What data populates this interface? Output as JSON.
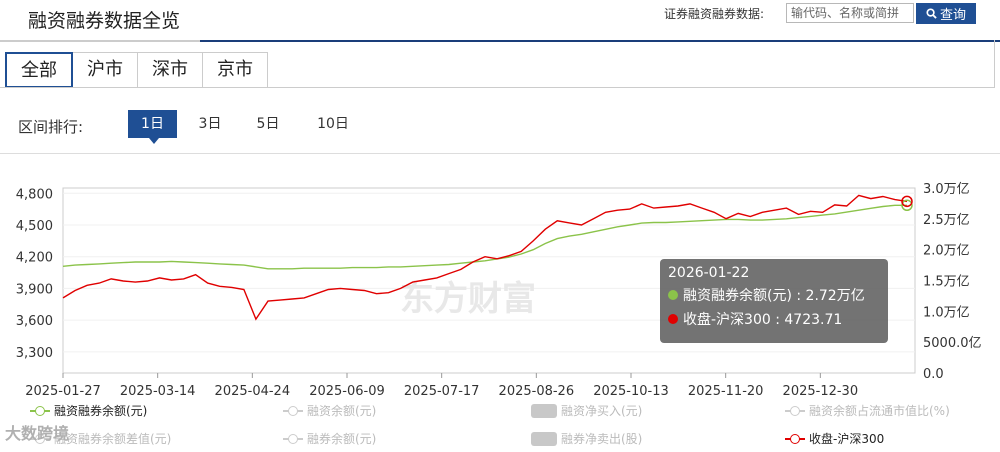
{
  "header": {
    "title": "融资融券数据全览",
    "search_label": "证券融资融券数据:",
    "search_placeholder": "输代码、名称或简拼",
    "search_button": "查询"
  },
  "tabs": [
    {
      "label": "全部",
      "active": true
    },
    {
      "label": "沪市",
      "active": false
    },
    {
      "label": "深市",
      "active": false
    },
    {
      "label": "京市",
      "active": false
    }
  ],
  "range": {
    "label": "区间排行:",
    "options": [
      {
        "label": "1日",
        "active": true
      },
      {
        "label": "3日",
        "active": false
      },
      {
        "label": "5日",
        "active": false
      },
      {
        "label": "10日",
        "active": false
      }
    ]
  },
  "legend": [
    {
      "label": "融资融券余额(元)",
      "style": "line-dot",
      "color": "#8bc34a",
      "active": true
    },
    {
      "label": "融资余额(元)",
      "style": "line-dot",
      "color": "#cccccc",
      "active": false
    },
    {
      "label": "融资净买入(元)",
      "style": "box",
      "color": "#cccccc",
      "active": false
    },
    {
      "label": "融资余额占流通市值比(%)",
      "style": "line-dot",
      "color": "#cccccc",
      "active": false
    },
    {
      "label": "融资融券余额差值(元)",
      "style": "line-dot",
      "color": "#cccccc",
      "active": false
    },
    {
      "label": "融券余额(元)",
      "style": "line-dot",
      "color": "#cccccc",
      "active": false
    },
    {
      "label": "融券净卖出(股)",
      "style": "box",
      "color": "#cccccc",
      "active": false
    },
    {
      "label": "收盘-沪深300",
      "style": "line-dot",
      "color": "#e00000",
      "active": true
    }
  ],
  "tooltip": {
    "date": "2026-01-22",
    "row1": "融资融券余额(元) : 2.72万亿",
    "row2": "收盘-沪深300 : 4723.71"
  },
  "watermark": "东方财富",
  "footer_watermark": "大数跨境",
  "colors": {
    "accent": "#1f4f94",
    "balance": "#8bc34a",
    "index": "#e00000"
  },
  "chart_data": {
    "type": "line",
    "x_ticks": [
      "2025-01-27",
      "2025-03-14",
      "2025-04-24",
      "2025-06-09",
      "2025-07-17",
      "2025-08-26",
      "2025-10-13",
      "2025-11-20",
      "2025-12-30"
    ],
    "y_left_ticks": [
      "3,300",
      "3,600",
      "3,900",
      "4,200",
      "4,500",
      "4,800"
    ],
    "y_left_range": [
      3100,
      4850
    ],
    "y_right_ticks": [
      "0.0",
      "5000.0亿",
      "1.0万亿",
      "1.5万亿",
      "2.0万亿",
      "2.5万亿",
      "3.0万亿"
    ],
    "y_right_range": [
      0,
      3.0
    ],
    "series": [
      {
        "name": "融资融券余额(元)",
        "axis": "right",
        "unit": "万亿",
        "values": [
          1.73,
          1.75,
          1.76,
          1.77,
          1.78,
          1.79,
          1.8,
          1.8,
          1.8,
          1.81,
          1.8,
          1.79,
          1.78,
          1.77,
          1.76,
          1.75,
          1.72,
          1.69,
          1.69,
          1.69,
          1.7,
          1.7,
          1.7,
          1.7,
          1.71,
          1.71,
          1.71,
          1.72,
          1.72,
          1.73,
          1.74,
          1.75,
          1.76,
          1.78,
          1.8,
          1.82,
          1.85,
          1.88,
          1.93,
          2.0,
          2.1,
          2.18,
          2.22,
          2.25,
          2.29,
          2.33,
          2.37,
          2.4,
          2.43,
          2.44,
          2.44,
          2.45,
          2.46,
          2.47,
          2.48,
          2.49,
          2.49,
          2.48,
          2.48,
          2.49,
          2.5,
          2.52,
          2.54,
          2.56,
          2.58,
          2.61,
          2.64,
          2.67,
          2.7,
          2.72,
          2.72
        ]
      },
      {
        "name": "收盘-沪深300",
        "axis": "left",
        "values": [
          3810,
          3880,
          3930,
          3950,
          3990,
          3970,
          3960,
          3970,
          4000,
          3980,
          3990,
          4030,
          3950,
          3920,
          3910,
          3890,
          3610,
          3780,
          3790,
          3800,
          3810,
          3850,
          3890,
          3900,
          3890,
          3880,
          3850,
          3860,
          3900,
          3960,
          3980,
          4000,
          4040,
          4080,
          4150,
          4200,
          4180,
          4210,
          4250,
          4350,
          4460,
          4540,
          4520,
          4500,
          4560,
          4620,
          4640,
          4650,
          4700,
          4660,
          4670,
          4680,
          4700,
          4660,
          4620,
          4560,
          4610,
          4580,
          4620,
          4640,
          4660,
          4600,
          4630,
          4620,
          4690,
          4680,
          4780,
          4750,
          4770,
          4740,
          4723.71
        ]
      }
    ],
    "highlight": {
      "date": "2026-01-22",
      "balance": 2.72,
      "close": 4723.71
    }
  }
}
